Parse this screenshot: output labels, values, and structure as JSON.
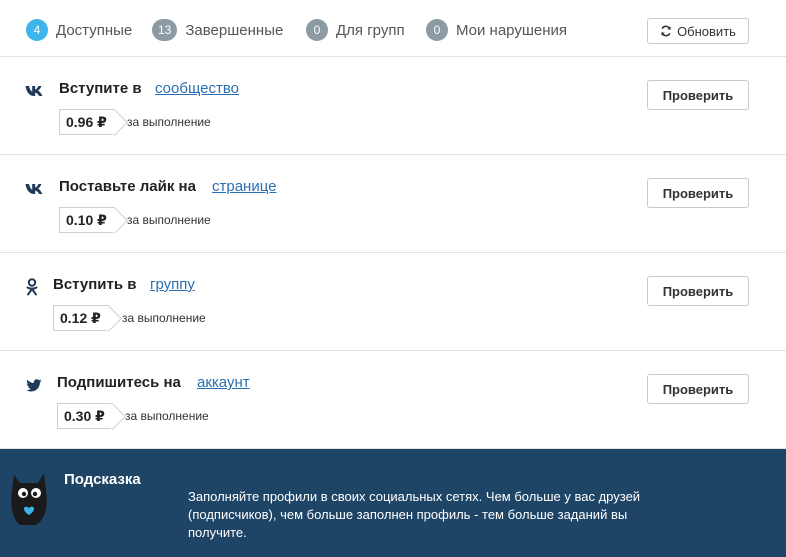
{
  "tabs": [
    {
      "count": "4",
      "label": "Доступные",
      "active": true
    },
    {
      "count": "13",
      "label": "Завершенные",
      "active": false
    },
    {
      "count": "0",
      "label": "Для групп",
      "active": false
    },
    {
      "count": "0",
      "label": "Мои нарушения",
      "active": false
    }
  ],
  "refresh_label": "Обновить",
  "tasks": [
    {
      "network_icon": "vk-icon",
      "title": "Вступите в",
      "link": "сообщество",
      "price": "0.96 ₽",
      "price_note": "за выполнение",
      "button": "Проверить"
    },
    {
      "network_icon": "vk-icon",
      "title": "Поставьте лайк на",
      "link": "странице",
      "price": "0.10 ₽",
      "price_note": "за выполнение",
      "button": "Проверить"
    },
    {
      "network_icon": "odnoklassniki-icon",
      "title": "Вступить в",
      "link": "группу",
      "price": "0.12 ₽",
      "price_note": "за выполнение",
      "button": "Проверить"
    },
    {
      "network_icon": "twitter-icon",
      "title": "Подпишитесь на",
      "link": "аккаунт",
      "price": "0.30 ₽",
      "price_note": "за выполнение",
      "button": "Проверить"
    }
  ],
  "hint": {
    "title": "Подсказка",
    "text": "Заполняйте профили в своих социальных сетях. Чем больше у вас друзей (подписчиков), чем больше заполнен профиль - тем больше заданий вы получите."
  },
  "colors": {
    "accent": "#3db5ec",
    "badge": "#8c9aa4",
    "link": "#2a6fb3",
    "hint_bg": "#1f4566"
  }
}
